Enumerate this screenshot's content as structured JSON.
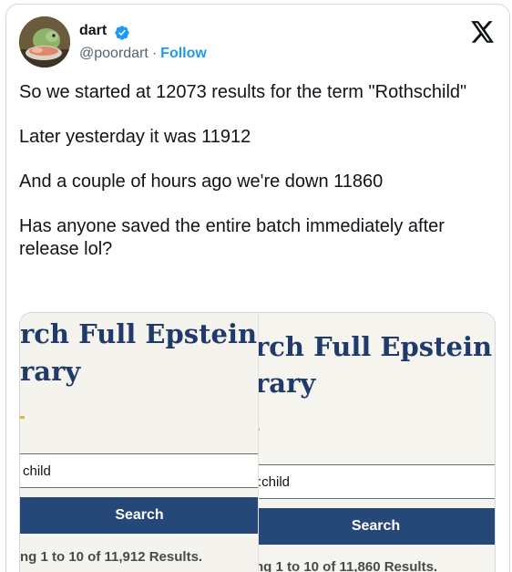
{
  "author": {
    "name": "dart",
    "handle": "@poordart",
    "separator": "·",
    "follow_label": "Follow"
  },
  "tweet": {
    "paragraphs": [
      "So we started at 12073 results for the term \"Rothschild\"",
      "Later yesterday it was 11912",
      "And a couple of hours ago we're down 11860",
      "Has anyone saved the entire batch immediately after release lol?"
    ]
  },
  "media": {
    "front": {
      "title_line1": "rch Full Epstein",
      "title_line2": "rary",
      "search_value": "child",
      "search_button": "Search",
      "results_text": "ng 1 to 10 of 11,912 Results."
    },
    "back": {
      "title_line1": "rch Full Epstein",
      "title_line2": "rary",
      "search_value": ":child",
      "search_button": "Search",
      "results_text": "ng 1 to 10 of 11,860 Results."
    }
  },
  "colors": {
    "follow": "#1d9bf0",
    "verified": "#1d9bf0",
    "heading": "#1f3a6b",
    "button": "#254878",
    "accent_dot": "#e0b646"
  },
  "icons": [
    "verified-badge-icon",
    "x-logo-icon",
    "avatar"
  ]
}
